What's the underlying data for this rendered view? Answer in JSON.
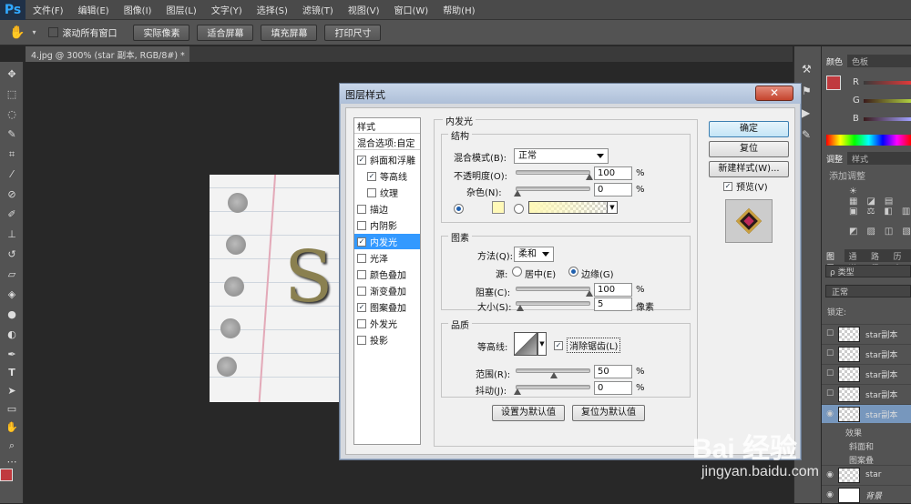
{
  "app": {
    "logo": "Ps"
  },
  "menu": [
    "文件(F)",
    "编辑(E)",
    "图像(I)",
    "图层(L)",
    "文字(Y)",
    "选择(S)",
    "滤镜(T)",
    "视图(V)",
    "窗口(W)",
    "帮助(H)"
  ],
  "options": {
    "scroll_all": "滚动所有窗口",
    "buttons": [
      "实际像素",
      "适合屏幕",
      "填充屏幕",
      "打印尺寸"
    ]
  },
  "document_tab": "4.jpg @ 300% (star 副本, RGB/8#) *",
  "canvas": {
    "letter": "S"
  },
  "right_panel": {
    "color_tabs": [
      "颜色",
      "色板"
    ],
    "rgb_labels": [
      "R",
      "G",
      "B"
    ],
    "adjust_tabs": [
      "调整",
      "样式"
    ],
    "add_adjust": "添加调整",
    "layer_tabs": [
      "图层",
      "通道",
      "路径",
      "历史"
    ],
    "kind": "ρ 类型",
    "blend": "正常",
    "lock": "锁定:",
    "layers": [
      "star副本",
      "star副本",
      "star副本",
      "star副本",
      "star副本"
    ],
    "effects": "效果",
    "effect_items": [
      "斜面和",
      "图案叠"
    ],
    "star": "star",
    "background": "背景"
  },
  "dialog": {
    "title": "图层样式",
    "close": "✕",
    "style_header": "样式",
    "blend_opts": "混合选项:自定",
    "styles": [
      {
        "label": "斜面和浮雕",
        "checked": true
      },
      {
        "label": "等高线",
        "checked": true
      },
      {
        "label": "纹理",
        "checked": false
      },
      {
        "label": "描边",
        "checked": false
      },
      {
        "label": "内阴影",
        "checked": false
      },
      {
        "label": "内发光",
        "checked": true
      },
      {
        "label": "光泽",
        "checked": false
      },
      {
        "label": "颜色叠加",
        "checked": false
      },
      {
        "label": "渐变叠加",
        "checked": false
      },
      {
        "label": "图案叠加",
        "checked": true
      },
      {
        "label": "外发光",
        "checked": false
      },
      {
        "label": "投影",
        "checked": false
      }
    ],
    "panel_title": "内发光",
    "structure": {
      "title": "结构",
      "blend_mode_label": "混合模式(B):",
      "blend_mode": "正常",
      "opacity_label": "不透明度(O):",
      "opacity": "100",
      "noise_label": "杂色(N):",
      "noise": "0",
      "pct": "%",
      "glow_color": "#fff9b8"
    },
    "elements": {
      "title": "图素",
      "technique_label": "方法(Q):",
      "technique": "柔和",
      "source_label": "源:",
      "center": "居中(E)",
      "edge": "边缘(G)",
      "choke_label": "阻塞(C):",
      "choke": "100",
      "size_label": "大小(S):",
      "size": "5",
      "px": "像素"
    },
    "quality": {
      "title": "品质",
      "contour_label": "等高线:",
      "antialias": "消除锯齿(L)",
      "range_label": "范围(R):",
      "range": "50",
      "jitter_label": "抖动(J):",
      "jitter": "0"
    },
    "make_default": "设置为默认值",
    "reset_default": "复位为默认值",
    "ok": "确定",
    "reset": "复位",
    "new_style": "新建样式(W)...",
    "preview": "预览(V)"
  },
  "watermark": {
    "brand": "Bai 经验",
    "url": "jingyan.baidu.com"
  }
}
